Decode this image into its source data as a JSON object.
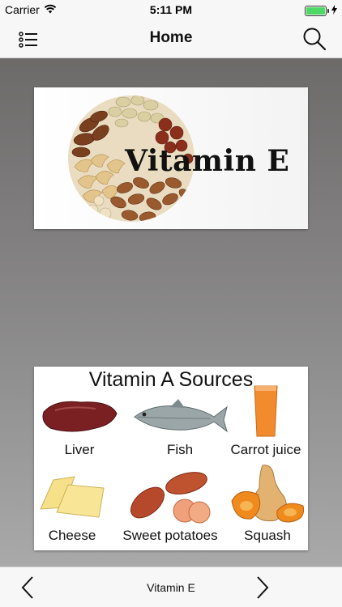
{
  "status_bar": {
    "carrier": "Carrier",
    "time": "5:11 PM",
    "battery_level": 1.0,
    "battery_color": "#4cd964",
    "icons": [
      "wifi-icon",
      "battery-icon",
      "charging-bolt-icon"
    ]
  },
  "nav": {
    "title": "Home",
    "menu_icon": "list-icon",
    "search_icon": "search-icon"
  },
  "cards": {
    "vitamin_e": {
      "text": "Vitamin E"
    },
    "vitamin_a": {
      "title": "Vitamin A Sources",
      "foods": [
        "Liver",
        "Fish",
        "Carrot juice",
        "Cheese",
        "Sweet potatoes",
        "Squash"
      ]
    }
  },
  "bottom_bar": {
    "label": "Vitamin E",
    "prev_icon": "chevron-left-icon",
    "next_icon": "chevron-right-icon"
  },
  "colors": {
    "bar_background": "#f7f7f7",
    "content_background_top": "#6d6a6a",
    "content_background_bottom": "#a9a9a9"
  }
}
